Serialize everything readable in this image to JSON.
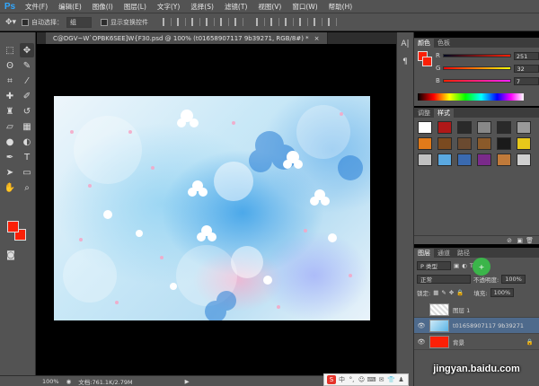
{
  "app": {
    "logo": "Ps",
    "menu": [
      "文件(F)",
      "编辑(E)",
      "图像(I)",
      "图层(L)",
      "文字(Y)",
      "选择(S)",
      "滤镜(T)",
      "视图(V)",
      "窗口(W)",
      "帮助(H)"
    ]
  },
  "options": {
    "auto_select_label": "自动选择：",
    "auto_select_value": "组",
    "show_transform_label": "显示变换控件"
  },
  "document": {
    "tab_title": "C@DGV~W`OPBK6SEE]W{F30.psd @ 100% (t01658907117 9b39271, RGB/8#) *",
    "status_zoom": "100%",
    "status_doc": "文档:761.1K/2.79M"
  },
  "color_panel": {
    "tabs": [
      "颜色",
      "色板"
    ],
    "r_label": "R",
    "r_value": "251",
    "g_label": "G",
    "g_value": "32",
    "b_label": "B",
    "b_value": "7",
    "fg_color": "#fb2007"
  },
  "styles_panel": {
    "tabs": [
      "调整",
      "样式"
    ],
    "swatches": [
      "#ffffff",
      "#b01818",
      "#2a2a2a",
      "#888888",
      "#2a2a2a",
      "#9a9a9a",
      "#e07a1a",
      "#7a4a20",
      "#6a4a30",
      "#8a5a2a",
      "#1a1a1a",
      "#e8c81a",
      "#c0c0c0",
      "#5aa8e0",
      "#3a6ab0",
      "#7a2a8a",
      "#c07a3a",
      "#d0d0d0"
    ]
  },
  "layers_panel": {
    "tabs": [
      "图层",
      "通道",
      "路径"
    ],
    "kind_label": "P 类型",
    "blend_mode": "正常",
    "opacity_label": "不透明度:",
    "opacity_value": "100%",
    "lock_label": "锁定:",
    "fill_label": "填充:",
    "fill_value": "100%",
    "layers": [
      {
        "name": "图层 1",
        "visible": false,
        "thumb": "transparent"
      },
      {
        "name": "t01658907117 9b39271",
        "visible": true,
        "thumb": "photo"
      },
      {
        "name": "背景",
        "visible": true,
        "thumb": "red"
      }
    ],
    "badge": "+"
  },
  "overlay": {
    "watermark": "jingyan.baidu.com",
    "ime_logo": "S",
    "ime_items": [
      "中",
      "°,",
      "☺",
      "⌨",
      "✉",
      "👕",
      "♟"
    ]
  }
}
